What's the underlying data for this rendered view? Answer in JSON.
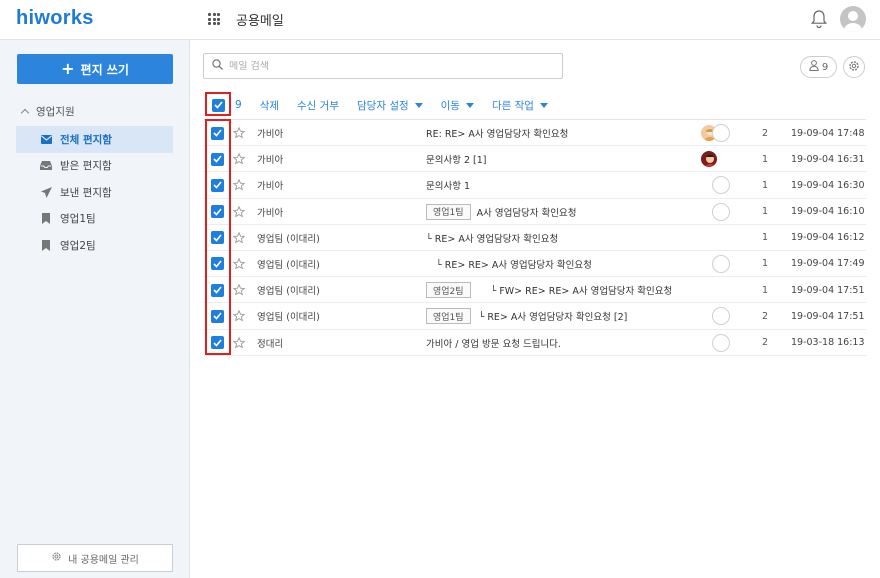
{
  "header": {
    "logo": "hiworks",
    "app_title": "공용메일"
  },
  "sidebar": {
    "compose_label": "편지 쓰기",
    "group_label": "영업지원",
    "items": [
      {
        "label": "전체 편지함",
        "icon": "envelope-icon",
        "active": true
      },
      {
        "label": "받은 편지함",
        "icon": "inbox-icon",
        "active": false
      },
      {
        "label": "보낸 편지함",
        "icon": "send-icon",
        "active": false
      },
      {
        "label": "영업1팀",
        "icon": "bookmark-icon",
        "active": false
      },
      {
        "label": "영업2팀",
        "icon": "bookmark-icon",
        "active": false
      }
    ],
    "manage_label": "내 공용메일 관리"
  },
  "search": {
    "placeholder": "메일 검색"
  },
  "people_count": "9",
  "toolbar": {
    "selected_count": "9",
    "delete_label": "삭제",
    "reject_label": "수신 거부",
    "assign_label": "담당자 설정",
    "move_label": "이동",
    "other_label": "다른 작업"
  },
  "messages": [
    {
      "sender": "가비아",
      "tag": "",
      "subject": "RE: RE> A사 영업담당자 확인요청",
      "count": "2",
      "date": "19-09-04 17:48"
    },
    {
      "sender": "가비아",
      "tag": "",
      "subject": "문의사항 2 [1]",
      "count": "1",
      "date": "19-09-04 16:31"
    },
    {
      "sender": "가비아",
      "tag": "",
      "subject": "문의사항 1",
      "count": "1",
      "date": "19-09-04 16:30"
    },
    {
      "sender": "가비아",
      "tag": "영업1팀",
      "subject": "A사 영업담당자 확인요청",
      "count": "1",
      "date": "19-09-04 16:10"
    },
    {
      "sender": "영업팀 (이대리)",
      "tag": "",
      "subject": "└ RE> A사 영업담당자 확인요청",
      "count": "1",
      "date": "19-09-04 16:12"
    },
    {
      "sender": "영업팀 (이대리)",
      "tag": "",
      "subject": "└ RE> RE> A사 영업담당자 확인요청",
      "count": "1",
      "date": "19-09-04 17:49"
    },
    {
      "sender": "영업팀 (이대리)",
      "tag": "영업2팀",
      "subject": "└ FW> RE> RE> A사 영업담당자 확인요청",
      "count": "1",
      "date": "19-09-04 17:51"
    },
    {
      "sender": "영업팀 (이대리)",
      "tag": "영업1팀",
      "subject": "└ RE> A사 영업담당자 확인요청 [2]",
      "count": "2",
      "date": "19-09-04 17:51"
    },
    {
      "sender": "정대리",
      "tag": "",
      "subject": "가비아 / 영업 방문 요청 드립니다.",
      "count": "2",
      "date": "19-03-18 16:13"
    }
  ],
  "colors": {
    "brand": "#1e7bd6",
    "accent": "#2c84dd",
    "highlight": "#e02020",
    "active_bg": "#d8e6f5"
  }
}
